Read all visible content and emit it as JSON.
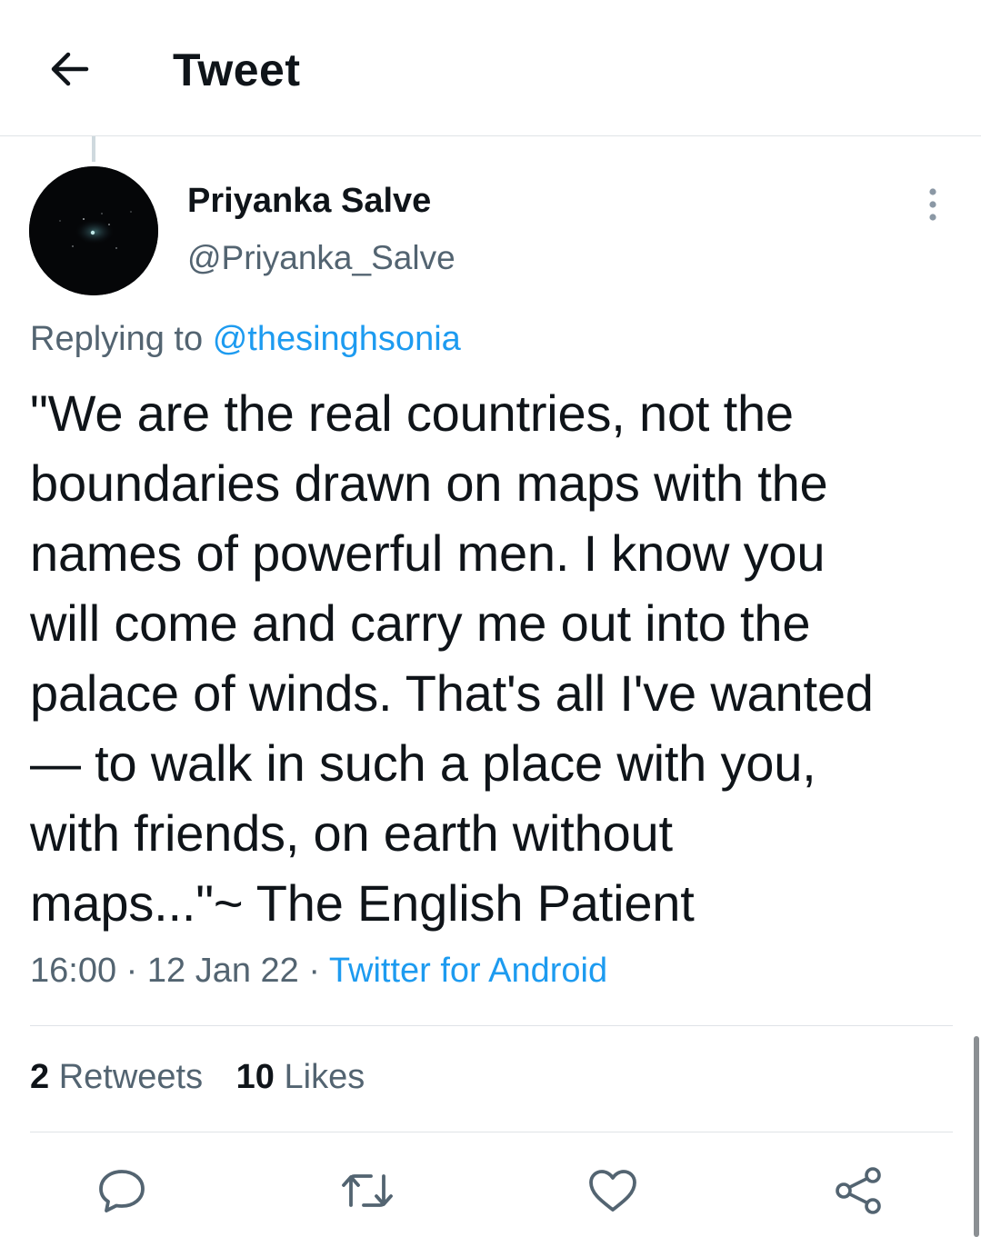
{
  "header": {
    "title": "Tweet",
    "back_icon": "arrow-left-icon"
  },
  "author": {
    "name": "Priyanka Salve",
    "handle": "@Priyanka_Salve",
    "avatar": "night-sky-avatar"
  },
  "reply": {
    "prefix": "Replying to",
    "mention": "@thesinghsonia"
  },
  "tweet": {
    "text": "\"We are the real countries, not the\nboundaries drawn on maps with the\nnames of powerful men. I know you\nwill come and carry me out into the\npalace of winds. That's all I've wanted\n— to walk in such a place with you,\nwith friends, on earth without\nmaps...\"~ The English Patient"
  },
  "meta": {
    "time": "16:00",
    "sep": "·",
    "date": "12 Jan 22",
    "source": "Twitter for Android"
  },
  "stats": {
    "retweets_count": "2",
    "retweets_label": "Retweets",
    "likes_count": "10",
    "likes_label": "Likes"
  },
  "actions": [
    "reply-icon",
    "retweet-icon",
    "like-icon",
    "share-icon"
  ],
  "colors": {
    "accent": "#1d9bf0",
    "text": "#0f1419",
    "secondary": "#536471",
    "divider": "#dfe3e7"
  }
}
